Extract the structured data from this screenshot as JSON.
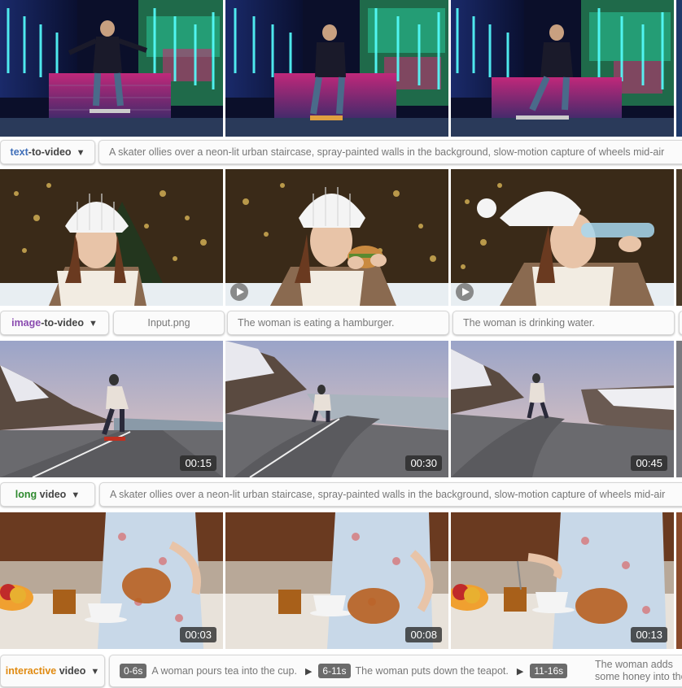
{
  "rows": [
    {
      "mode_keyword": "text",
      "mode_rest": "-to-video",
      "accent": "#3f6fb9",
      "prompt": "A skater ollies over a neon-lit urban staircase, spray-painted walls in the background, slow-motion capture of wheels mid-air"
    },
    {
      "mode_keyword": "image",
      "mode_rest": "-to-video",
      "accent": "#8a4bb0",
      "inputs": [
        "Input.png",
        "The woman is eating a hamburger.",
        "The woman is drinking water."
      ]
    },
    {
      "mode_keyword": "long",
      "mode_rest": " video",
      "accent": "#2f8a2f",
      "timestamps": [
        "00:15",
        "00:30",
        "00:45"
      ],
      "prompt": "A skater ollies over a neon-lit urban staircase, spray-painted walls in the background, slow-motion capture of wheels mid-air"
    },
    {
      "mode_keyword": "interactive",
      "mode_rest": " video",
      "accent": "#e08a10",
      "timestamps": [
        "00:03",
        "00:08",
        "00:13"
      ],
      "segments": [
        {
          "range": "0-6s",
          "text": "A woman pours tea into the cup."
        },
        {
          "range": "6-11s",
          "text": "The woman puts down the teapot."
        },
        {
          "range": "11-16s",
          "text": "The woman adds some honey into the cup."
        }
      ]
    }
  ],
  "icons": {
    "dropdown": "caret-down-icon",
    "play": "play-icon",
    "segment_separator": "triangle-right-icon"
  }
}
